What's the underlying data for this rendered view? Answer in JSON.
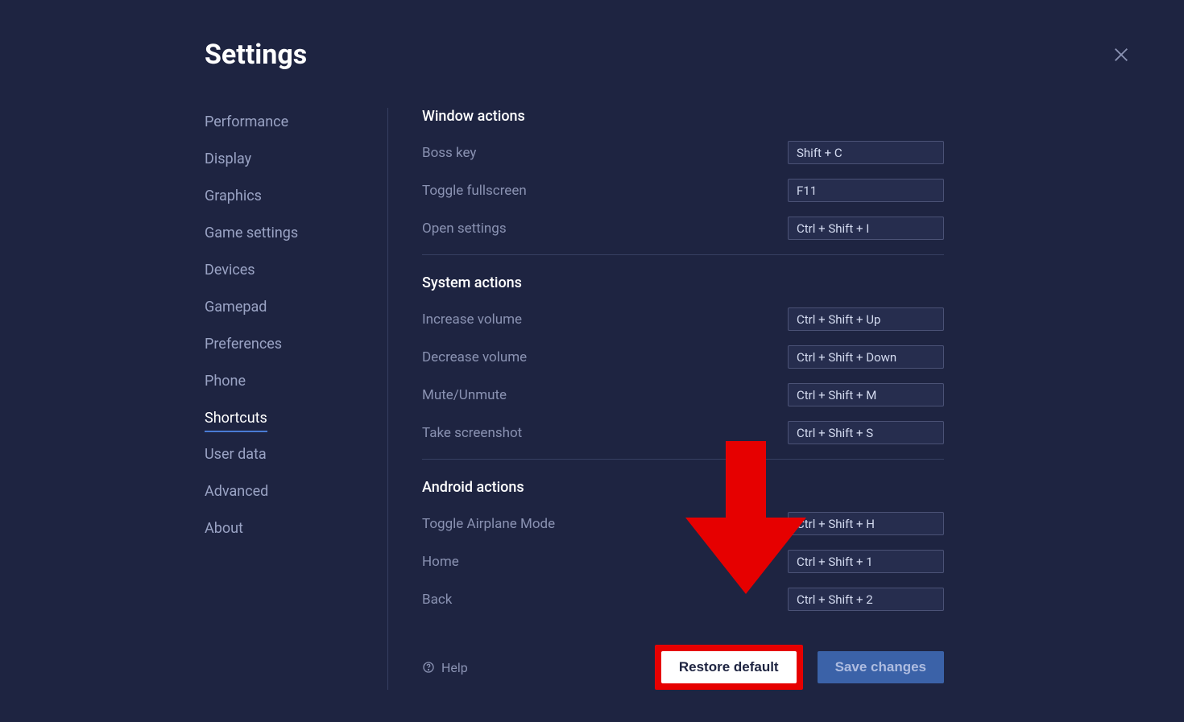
{
  "title": "Settings",
  "sidebar": {
    "items": [
      {
        "label": "Performance"
      },
      {
        "label": "Display"
      },
      {
        "label": "Graphics"
      },
      {
        "label": "Game settings"
      },
      {
        "label": "Devices"
      },
      {
        "label": "Gamepad"
      },
      {
        "label": "Preferences"
      },
      {
        "label": "Phone"
      },
      {
        "label": "Shortcuts"
      },
      {
        "label": "User data"
      },
      {
        "label": "Advanced"
      },
      {
        "label": "About"
      }
    ],
    "active_index": 8
  },
  "groups": [
    {
      "title": "Window actions",
      "rows": [
        {
          "label": "Boss key",
          "hotkey": "Shift + C"
        },
        {
          "label": "Toggle fullscreen",
          "hotkey": "F11"
        },
        {
          "label": "Open settings",
          "hotkey": "Ctrl + Shift + I"
        }
      ]
    },
    {
      "title": "System actions",
      "rows": [
        {
          "label": "Increase volume",
          "hotkey": "Ctrl + Shift + Up"
        },
        {
          "label": "Decrease volume",
          "hotkey": "Ctrl + Shift + Down"
        },
        {
          "label": "Mute/Unmute",
          "hotkey": "Ctrl + Shift + M"
        },
        {
          "label": "Take screenshot",
          "hotkey": "Ctrl + Shift + S"
        }
      ]
    },
    {
      "title": "Android actions",
      "rows": [
        {
          "label": "Toggle Airplane Mode",
          "hotkey": "Ctrl + Shift + H"
        },
        {
          "label": "Home",
          "hotkey": "Ctrl + Shift + 1"
        },
        {
          "label": "Back",
          "hotkey": "Ctrl + Shift + 2"
        }
      ]
    }
  ],
  "help_label": "Help",
  "restore_label": "Restore default",
  "save_label": "Save changes",
  "annotation": {
    "arrow_color": "#e60000"
  }
}
